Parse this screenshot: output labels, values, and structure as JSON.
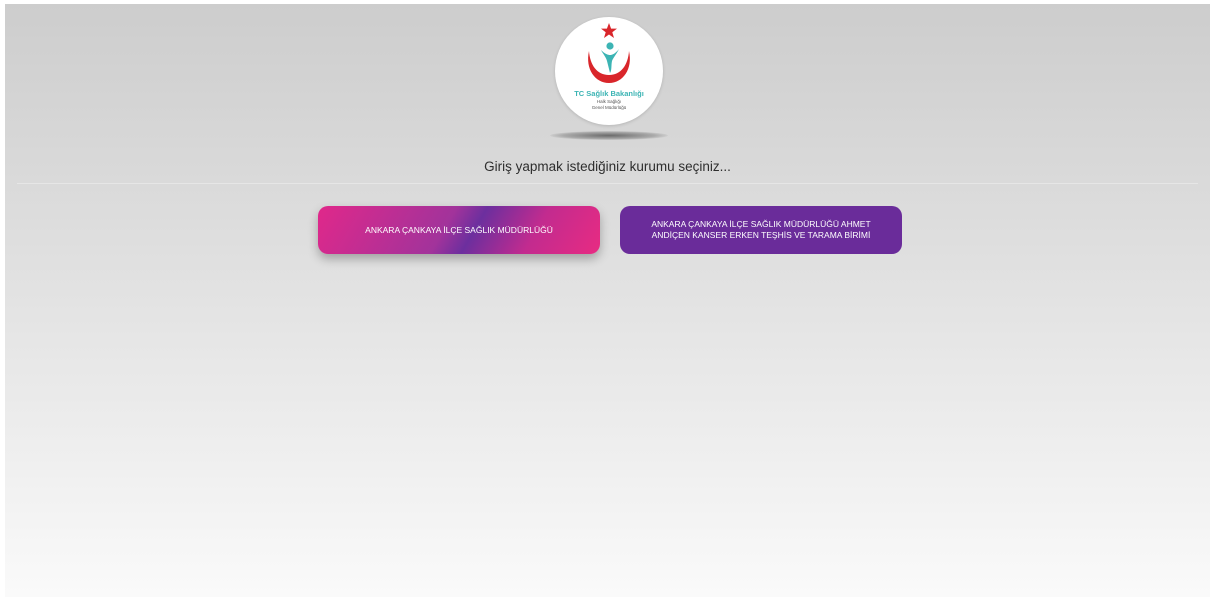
{
  "logo": {
    "title": "TC Sağlık Bakanlığı",
    "subtitle_line1": "Halk Sağlığı",
    "subtitle_line2": "Genel Müdürlüğü",
    "colors": {
      "crescent": "#d9262b",
      "star": "#d9262b",
      "figure": "#3cb4b4",
      "text": "#3cb4b4"
    }
  },
  "prompt": "Giriş yapmak istediğiniz kurumu seçiniz...",
  "institutions": [
    {
      "label": "ANKARA ÇANKAYA İLÇE SAĞLIK MÜDÜRLÜĞÜ",
      "color": "#e0288a"
    },
    {
      "label_line1": "ANKARA ÇANKAYA İLÇE SAĞLIK MÜDÜRLÜĞÜ AHMET",
      "label_line2": "ANDİÇEN KANSER ERKEN TEŞHİS VE TARAMA BİRİMİ",
      "color": "#6a2c9a"
    }
  ]
}
